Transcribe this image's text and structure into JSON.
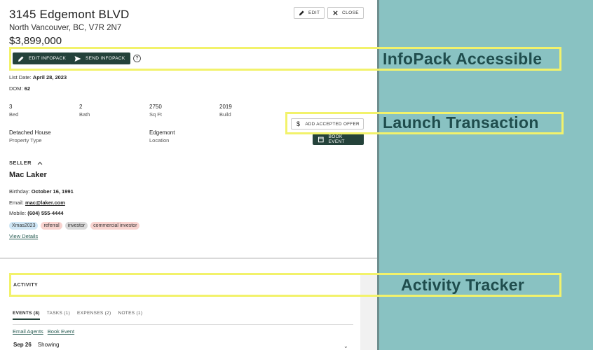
{
  "listing": {
    "title": "3145 Edgemont BLVD",
    "address": "North Vancouver, BC, V7R 2N7",
    "price": "$3,899,000",
    "list_date_label": "List Date:",
    "list_date": "April 28, 2023",
    "dom_label": "DOM:",
    "dom": "62"
  },
  "toolbar": {
    "edit_label": "EDIT",
    "close_label": "CLOSE"
  },
  "infopack": {
    "edit_label": "EDIT INFOPACK",
    "send_label": "SEND INFOPACK",
    "help": "?"
  },
  "stats": [
    {
      "value": "3",
      "label": "Bed"
    },
    {
      "value": "2",
      "label": "Bath"
    },
    {
      "value": "2750",
      "label": "Sq Ft"
    },
    {
      "value": "2019",
      "label": "Build"
    }
  ],
  "details": [
    {
      "value": "Detached House",
      "label": "Property Type"
    },
    {
      "value": "Edgemont",
      "label": "Location"
    }
  ],
  "actions": {
    "accepted_offer_label": "ADD ACCEPTED OFFER",
    "book_event_label": "BOOK EVENT"
  },
  "seller": {
    "section_label": "SELLER",
    "name": "Mac Laker",
    "birthday_label": "Birthday:",
    "birthday": "October 16, 1991",
    "email_label": "Email:",
    "email": "mac@laker.com",
    "mobile_label": "Mobile:",
    "mobile": "(604) 555-4444",
    "tags": [
      {
        "label": "Xmas2023",
        "color": "#cfe6f5"
      },
      {
        "label": "referral",
        "color": "#f8d3cf"
      },
      {
        "label": "investor",
        "color": "#d9d9d9"
      },
      {
        "label": "commercial investor",
        "color": "#f8d3cf"
      }
    ],
    "view_details": "View Details"
  },
  "activity": {
    "title": "ACTIVITY",
    "tabs": [
      "EVENTS (8)",
      "TASKS (1)",
      "EXPENSES (2)",
      "NOTES (1)"
    ],
    "links": [
      "Email Agents",
      "Book Event"
    ],
    "day": "Sep 26",
    "showing": "Showing"
  },
  "annotations": {
    "infopack": "InfoPack Accessible",
    "transaction": "Launch Transaction",
    "activity": "Activity Tracker",
    "highlight_color": "#f2f26b"
  }
}
